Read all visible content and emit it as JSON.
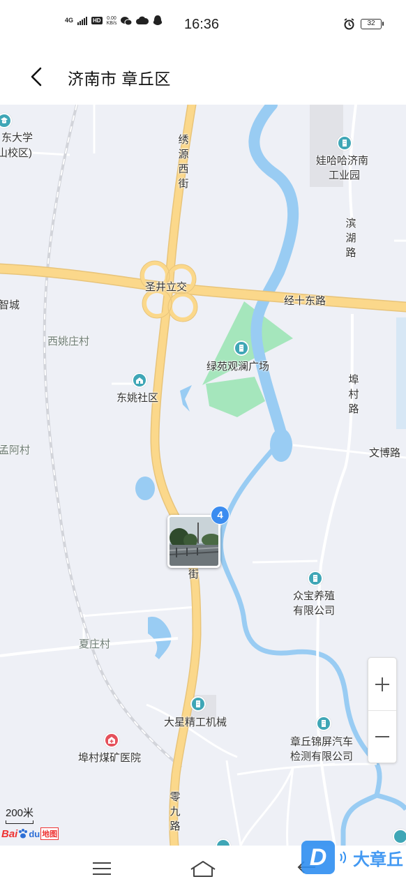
{
  "status_bar": {
    "network": "4G",
    "hd": "HD",
    "speed_value": "0.00",
    "speed_unit": "KB/s",
    "time": "16:36",
    "battery": "32"
  },
  "header": {
    "back_icon": "chevron-left-icon",
    "title": "济南市 章丘区"
  },
  "map": {
    "colors": {
      "background": "#eef0f6",
      "water": "#99ccf3",
      "main_road": "#fbd88b",
      "park": "#a5e6bc"
    },
    "labels": {
      "university_top": "东大学",
      "university_bottom": "山校区)",
      "wahaha_line1": "娃哈哈济南",
      "wahaha_line2": "工业园",
      "xiuyuan_road": "绣源西街",
      "binhu_road": "滨湖路",
      "shengjing_interchange": "圣井立交",
      "jingshi_road": "经十东路",
      "zhicheng": "智城",
      "xiyaozhuang": "西姚庄村",
      "lvyuan_plaza": "绿苑观澜广场",
      "dongyao": "东姚社区",
      "bucun_road": "埠村路",
      "mengacun": "孟阿村",
      "wenbo_road": "文博路",
      "street_fragment": "街",
      "zhongbao_line1": "众宝养殖",
      "zhongbao_line2": "有限公司",
      "xiazhuang": "夏庄村",
      "daxing": "大星精工机械",
      "jinping_line1": "章丘锦屏汽车",
      "jinping_line2": "检测有限公司",
      "hospital": "埠村煤矿医院",
      "lingjiu_road": "零九路"
    },
    "photo_marker": {
      "count": "4"
    },
    "zoom": {
      "in_icon": "plus-icon",
      "out_icon": "minus-icon"
    },
    "scale": "200米",
    "logo": {
      "bai": "Bai",
      "du": "du",
      "sub": "地图"
    }
  },
  "bottom_nav": {
    "menu_icon": "menu-icon",
    "home_icon": "home-icon",
    "back_icon": "back-icon"
  },
  "watermark": {
    "text": "大章丘"
  }
}
